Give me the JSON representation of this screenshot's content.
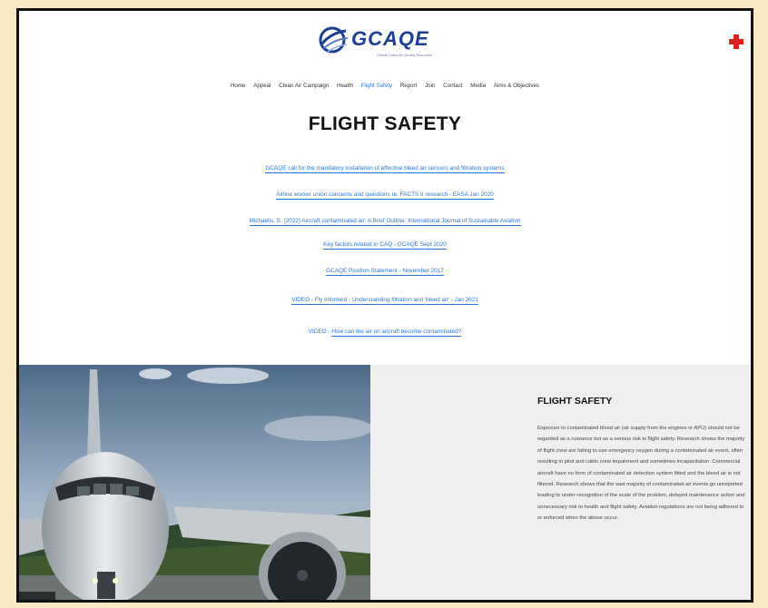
{
  "brand": {
    "name": "GCAQE",
    "tagline": "Global Cabin Air Quality Executive"
  },
  "nav": {
    "items": [
      "Home",
      "Appeal",
      "Clean Air Campaign",
      "Health",
      "Flight Safety",
      "Report",
      "Join",
      "Contact",
      "Media",
      "Aims & Objectives"
    ],
    "active": "Flight Safety"
  },
  "page": {
    "title": "FLIGHT SAFETY"
  },
  "links": [
    "GCAQE call for the mandatory installation of effective bleed air sensors and filtration systems",
    "Airline worker union concerns and questions re. FACTS II research - EASA Jan 2020",
    "Michaelis, S. (2022) Aircraft contaminated air: A Brief Outline. International Journal of Sustainable Aviation",
    "Key factors related to CAQ - GCAQE Sept 2020",
    "GCAQE Position Statement - November 2017",
    "VIDEO - Fly Informed - Understanding filtration and 'bleed air' - Jan 2021",
    {
      "prefix": "VIDEO - ",
      "text": "How can the air on aircraft become contaminated?"
    }
  ],
  "section": {
    "title": "FLIGHT SAFETY",
    "body": "Exposure to contaminated bleed air (air supply from the engines or APU) should not be regarded as a nuisance but as a serious risk to flight safety. Research shows the majority of flight crew are failing to use emergency oxygen during a contaminated air event, often resulting in pilot and cabin crew impairment and sometimes incapacitation. Commercial aircraft have no form of contaminated air detection system fitted and the bleed air is not filtered. Research shows that the vast majority of contaminated air events go unreported leading to under-recognition of the scale of the problem, delayed maintenance action and unnecessary risk to health and flight safety. Aviation regulations are not being adhered to or enforced when the above occur."
  },
  "colors": {
    "accent": "#2a78d6",
    "brand": "#1c3f94",
    "cross": "#e0201c",
    "page_bg": "#fbe9c4"
  }
}
